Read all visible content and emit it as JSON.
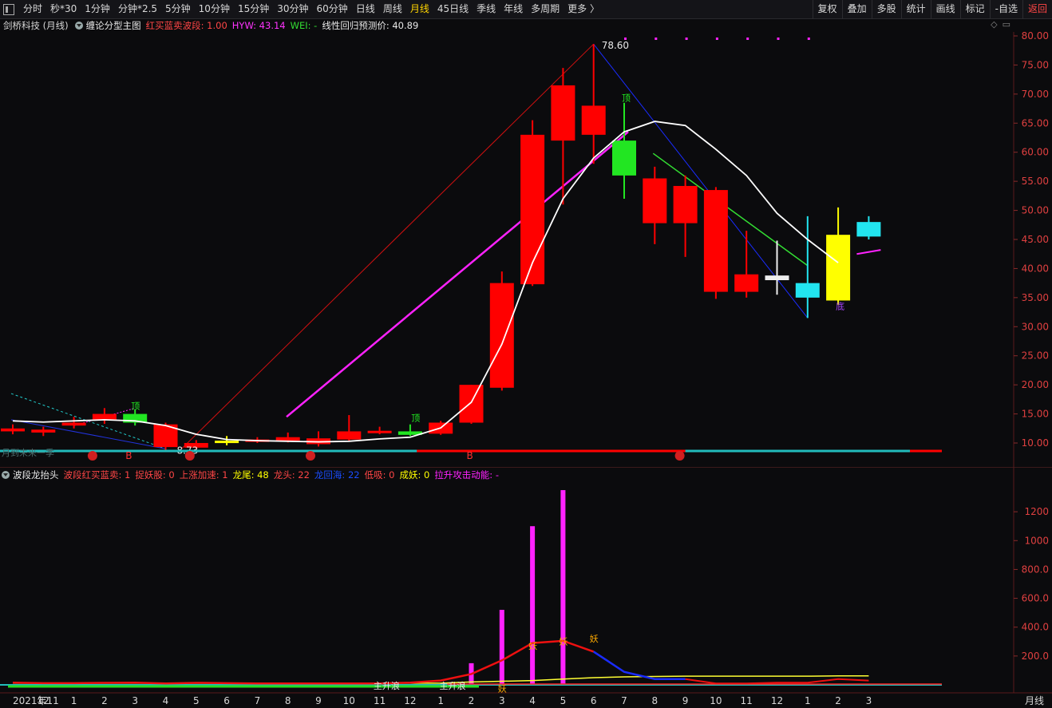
{
  "toolbar": {
    "periods": [
      "分时",
      "秒*30",
      "1分钟",
      "分钟*2.5",
      "5分钟",
      "10分钟",
      "15分钟",
      "30分钟",
      "60分钟",
      "日线",
      "周线",
      "月线",
      "45日线",
      "季线",
      "年线",
      "多周期",
      "更多 〉"
    ],
    "active": "月线",
    "right_buttons": [
      "复权",
      "叠加",
      "多股",
      "统计",
      "画线",
      "标记",
      "-自选",
      "返回"
    ]
  },
  "main_panel": {
    "stock": "剑桥科技 (月线)",
    "indicator": "缠论分型主图",
    "hmlm_label": "红买蓝卖波段: 1.00",
    "hyw_label": "HYW: 43.14",
    "wei_label": "WEI: -",
    "pred_label": "线性回归预测价: 40.89",
    "high_label": "78.60",
    "low_label": "8.73",
    "ding": "顶",
    "di": "底",
    "left_note": "月到未来一季",
    "price_ticks": [
      "80.00",
      "75.00",
      "70.00",
      "65.00",
      "60.00",
      "55.00",
      "50.00",
      "45.00",
      "40.00",
      "35.00",
      "30.00",
      "25.00",
      "20.00",
      "15.00",
      "10.00"
    ]
  },
  "sub_panel": {
    "title": "波段龙抬头",
    "items": [
      {
        "text": "波段红买蓝卖: 1",
        "color": "#ff4646"
      },
      {
        "text": "捉妖股: 0",
        "color": "#ff4646"
      },
      {
        "text": "上涨加速: 1",
        "color": "#ff4646"
      },
      {
        "text": "龙尾: 48",
        "color": "#ffff00"
      },
      {
        "text": "龙头: 22",
        "color": "#ff4646"
      },
      {
        "text": "龙回海: 22",
        "color": "#1a4dff"
      },
      {
        "text": "低吸: 0",
        "color": "#ff4646"
      },
      {
        "text": "成妖: 0",
        "color": "#ffff00"
      },
      {
        "text": "拉升攻击动能: -",
        "color": "#ff22ff"
      }
    ],
    "ticks": [
      "1200",
      "1000",
      "800.0",
      "600.0",
      "400.0",
      "200.0"
    ],
    "wave1": "主升浪",
    "wave2": "主升浪",
    "yao": "妖"
  },
  "x_axis": {
    "labels": [
      "2021年11",
      "12",
      "1",
      "2",
      "3",
      "4",
      "5",
      "6",
      "7",
      "8",
      "9",
      "10",
      "11",
      "12",
      "1",
      "2",
      "3",
      "4",
      "5",
      "6",
      "7",
      "8",
      "9",
      "10",
      "11",
      "12",
      "1",
      "2",
      "3"
    ],
    "period_label": "月线"
  },
  "chart_data": {
    "type": "candlestick",
    "categories": [
      "2021-11",
      "2021-12",
      "2022-01",
      "2022-02",
      "2022-03",
      "2022-04",
      "2022-05",
      "2022-06",
      "2022-07",
      "2022-08",
      "2022-09",
      "2022-10",
      "2022-11",
      "2022-12",
      "2023-01",
      "2023-02",
      "2023-03",
      "2023-04",
      "2023-05",
      "2023-06",
      "2023-07",
      "2023-08",
      "2023-09",
      "2023-10",
      "2023-11",
      "2023-12",
      "2024-01",
      "2024-02",
      "2024-03"
    ],
    "candles": [
      {
        "o": 12.5,
        "c": 12.0,
        "h": 13.2,
        "l": 11.5,
        "color": "#ff0000"
      },
      {
        "o": 12.3,
        "c": 11.8,
        "h": 12.8,
        "l": 11.2,
        "color": "#ff0000"
      },
      {
        "o": 13.5,
        "c": 13.0,
        "h": 14.5,
        "l": 12.5,
        "color": "#ff0000"
      },
      {
        "o": 15.0,
        "c": 14.0,
        "h": 16.0,
        "l": 13.3,
        "color": "#ff0000"
      },
      {
        "o": 13.5,
        "c": 15.0,
        "h": 15.8,
        "l": 13.0,
        "color": "#22e622"
      },
      {
        "o": 13.2,
        "c": 9.3,
        "h": 13.5,
        "l": 8.73,
        "color": "#ff0000"
      },
      {
        "o": 9.2,
        "c": 10.0,
        "h": 10.5,
        "l": 8.9,
        "color": "#ff0000"
      },
      {
        "o": 10.0,
        "c": 10.4,
        "h": 11.2,
        "l": 9.6,
        "color": "#ffff00"
      },
      {
        "o": 10.4,
        "c": 10.6,
        "h": 11.0,
        "l": 10.0,
        "color": "#ff0000"
      },
      {
        "o": 10.4,
        "c": 11.0,
        "h": 11.8,
        "l": 10.1,
        "color": "#ff0000"
      },
      {
        "o": 9.8,
        "c": 10.8,
        "h": 12.0,
        "l": 9.4,
        "color": "#ff0000"
      },
      {
        "o": 10.6,
        "c": 12.0,
        "h": 14.8,
        "l": 10.4,
        "color": "#ff0000"
      },
      {
        "o": 11.9,
        "c": 12.1,
        "h": 12.8,
        "l": 11.5,
        "color": "#ff0000"
      },
      {
        "o": 12.0,
        "c": 11.4,
        "h": 13.2,
        "l": 11.2,
        "color": "#22e622"
      },
      {
        "o": 11.6,
        "c": 13.5,
        "h": 13.8,
        "l": 11.4,
        "color": "#ff0000"
      },
      {
        "o": 13.5,
        "c": 20.0,
        "h": 20.0,
        "l": 13.3,
        "color": "#ff0000"
      },
      {
        "o": 19.5,
        "c": 37.5,
        "h": 39.5,
        "l": 19.0,
        "color": "#ff0000"
      },
      {
        "o": 37.3,
        "c": 63.0,
        "h": 65.5,
        "l": 37.0,
        "color": "#ff0000"
      },
      {
        "o": 62.0,
        "c": 71.5,
        "h": 74.5,
        "l": 51.0,
        "color": "#ff0000"
      },
      {
        "o": 63.0,
        "c": 68.0,
        "h": 78.6,
        "l": 58.0,
        "color": "#ff0000"
      },
      {
        "o": 62.0,
        "c": 56.0,
        "h": 68.5,
        "l": 52.0,
        "color": "#22e622"
      },
      {
        "o": 47.8,
        "c": 55.5,
        "h": 57.5,
        "l": 44.2,
        "color": "#ff0000"
      },
      {
        "o": 47.8,
        "c": 54.2,
        "h": 56.0,
        "l": 42.0,
        "color": "#ff0000"
      },
      {
        "o": 36.0,
        "c": 53.5,
        "h": 54.0,
        "l": 34.8,
        "color": "#ff0000"
      },
      {
        "o": 36.0,
        "c": 39.0,
        "h": 46.5,
        "l": 35.0,
        "color": "#ff0000"
      },
      {
        "o": 38.0,
        "c": 38.8,
        "h": 44.8,
        "l": 35.5,
        "color": "#eeeeee"
      },
      {
        "o": 35.0,
        "c": 37.5,
        "h": 49.0,
        "l": 31.5,
        "color": "#22e5f0"
      },
      {
        "o": 34.5,
        "c": 45.8,
        "h": 50.5,
        "l": 33.8,
        "color": "#ffff00"
      },
      {
        "o": 45.5,
        "c": 48.0,
        "h": 49.0,
        "l": 45.0,
        "color": "#22e5f0"
      }
    ],
    "ma_white": [
      13.8,
      13.6,
      13.8,
      14.0,
      13.8,
      13.0,
      11.5,
      10.6,
      10.4,
      10.3,
      10.2,
      10.3,
      10.7,
      11.0,
      12.6,
      17.0,
      27.0,
      41.0,
      52.0,
      59.0,
      63.5,
      65.3,
      64.6,
      60.5,
      56.0,
      49.5,
      45.0,
      41.0
    ],
    "sub_bars": [
      0,
      0,
      0,
      0,
      0,
      0,
      0,
      0,
      0,
      0,
      0,
      0,
      0,
      0,
      0,
      150,
      520,
      1100,
      1350,
      0,
      0,
      0,
      0,
      0,
      0,
      0,
      0,
      0,
      0
    ],
    "sub_red_line": [
      15,
      12,
      12,
      14,
      15,
      10,
      14,
      12,
      10,
      10,
      10,
      10,
      10,
      15,
      30,
      75,
      170,
      290,
      305,
      230,
      90,
      40,
      40,
      10,
      10,
      15,
      15,
      40,
      30
    ],
    "sub_yellow_line": [
      12,
      12,
      12,
      12,
      12,
      12,
      12,
      12,
      12,
      12,
      12,
      12,
      12,
      12,
      12,
      20,
      25,
      30,
      40,
      50,
      55,
      58,
      60,
      60,
      60,
      60,
      60,
      62,
      62
    ],
    "price_ylim": [
      8,
      80
    ],
    "sub_ylim": [
      0,
      1400
    ]
  }
}
